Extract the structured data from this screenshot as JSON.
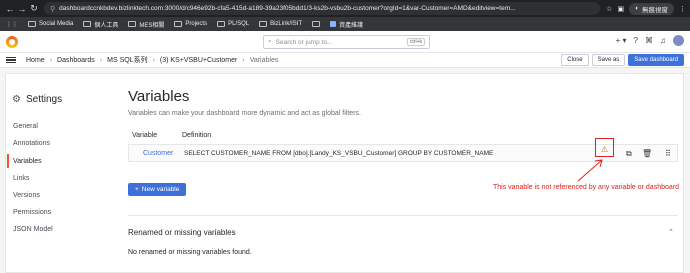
{
  "browser": {
    "url": "dashboardccnkbdev.bizlinktech.com:3000/d/c946e92b-cfa5-415d-a189-39a23f05bdd1/3-ks2b-vsbu2b-customer?orgId=1&var-Customer=AMD&editview=tem...",
    "profile_label": "無痕視窗",
    "bookmarks": [
      {
        "label": "Social Media"
      },
      {
        "label": "個人工具"
      },
      {
        "label": "MES相關"
      },
      {
        "label": "Projects"
      },
      {
        "label": "PL/SQL"
      },
      {
        "label": "BizLink/ISIT"
      },
      {
        "label": ""
      },
      {
        "label": "資產維護"
      }
    ]
  },
  "topnav": {
    "search_placeholder": "Search or jump to...",
    "search_shortcut": "ctrl+k"
  },
  "breadcrumb": {
    "items": [
      "Home",
      "Dashboards",
      "MS SQL系列",
      "(3) KS+VSBU+Customer",
      "Variables"
    ]
  },
  "actions": {
    "close": "Close",
    "save_as": "Save as",
    "save_dashboard": "Save dashboard"
  },
  "sidebar": {
    "title": "Settings",
    "items": [
      {
        "label": "General"
      },
      {
        "label": "Annotations"
      },
      {
        "label": "Variables"
      },
      {
        "label": "Links"
      },
      {
        "label": "Versions"
      },
      {
        "label": "Permissions"
      },
      {
        "label": "JSON Model"
      }
    ],
    "active_index": 2
  },
  "main": {
    "title": "Variables",
    "subtitle": "Variables can make your dashboard more dynamic and act as global filters.",
    "columns": {
      "variable": "Variable",
      "definition": "Definition"
    },
    "variables": [
      {
        "name": "Customer",
        "definition": "SELECT CUSTOMER_NAME FROM [dbo].[Landy_KS_VSBU_Customer] GROUP BY CUSTOMER_NAME"
      }
    ],
    "annotation": "This variable is not referenced by any variable or dashboard",
    "new_variable_label": "New variable",
    "renamed_title": "Renamed or missing variables",
    "renamed_message": "No renamed or missing variables found."
  },
  "colors": {
    "accent": "#3d71d9",
    "active_marker": "#f05a28",
    "warning_highlight": "#e02020"
  },
  "icons": [
    "back-arrow-icon",
    "forward-arrow-icon",
    "reload-icon",
    "lock-icon",
    "folder-icon",
    "grafana-logo",
    "plus-icon",
    "help-icon",
    "rss-icon",
    "bell-icon",
    "gear-icon",
    "warning-icon",
    "duplicate-icon",
    "trash-icon",
    "drag-handle-icon",
    "chevron-down-icon"
  ]
}
